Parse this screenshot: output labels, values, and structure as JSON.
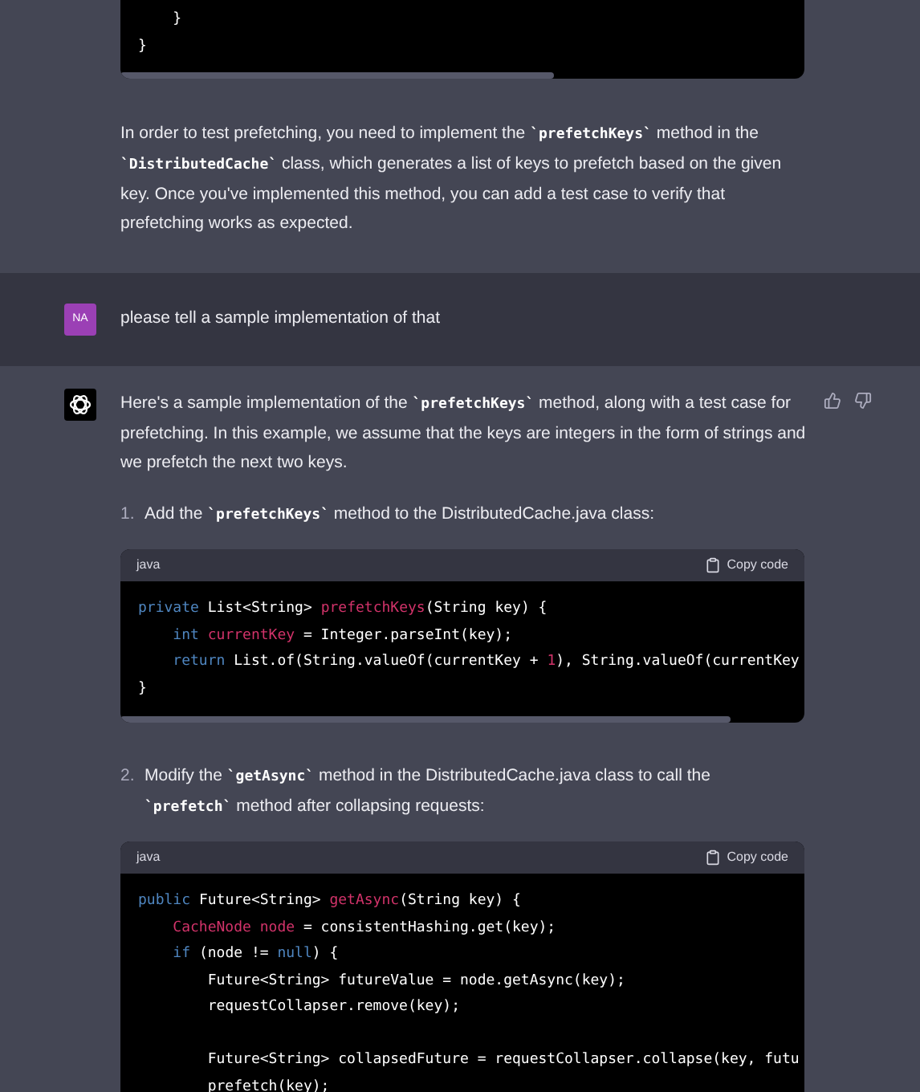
{
  "top_code_block": {
    "lines": [
      {
        "kind": "code",
        "tokens": [
          {
            "text": "    }",
            "kind": "plain"
          }
        ]
      },
      {
        "kind": "code",
        "tokens": [
          {
            "text": "}",
            "kind": "plain"
          }
        ]
      }
    ]
  },
  "assistant_message_1": {
    "paragraph": [
      {
        "text": "In order to test prefetching, you need to implement the ",
        "kind": "text"
      },
      {
        "text": "`prefetchKeys`",
        "kind": "code"
      },
      {
        "text": " method in the ",
        "kind": "text"
      },
      {
        "text": "`DistributedCache`",
        "kind": "code"
      },
      {
        "text": " class, which generates a list of keys to prefetch based on the given key. Once you've implemented this method, you can add a test case to verify that prefetching works as expected.",
        "kind": "text"
      }
    ]
  },
  "user_message": {
    "avatar": "NA",
    "text": "please tell a sample implementation of that"
  },
  "assistant_message_2": {
    "intro": [
      {
        "text": "Here's a sample implementation of the ",
        "kind": "text"
      },
      {
        "text": "`prefetchKeys`",
        "kind": "code"
      },
      {
        "text": " method, along with a test case for prefetching. In this example, we assume that the keys are integers in the form of strings and we prefetch the next two keys.",
        "kind": "text"
      }
    ],
    "steps": [
      {
        "number": "1.",
        "text": [
          {
            "text": "Add the ",
            "kind": "text"
          },
          {
            "text": "`prefetchKeys`",
            "kind": "code"
          },
          {
            "text": " method to the DistributedCache.java class:",
            "kind": "text"
          }
        ],
        "code_block": {
          "language": "java",
          "copy_label": "Copy code",
          "lines": [
            {
              "kind": "code",
              "tokens": [
                {
                  "text": "private ",
                  "kind": "keyword"
                },
                {
                  "text": "List<String> ",
                  "kind": "plain"
                },
                {
                  "text": "prefetchKeys",
                  "kind": "title"
                },
                {
                  "text": "(String key) {",
                  "kind": "plain"
                }
              ]
            },
            {
              "kind": "code",
              "tokens": [
                {
                  "text": "    int ",
                  "kind": "keyword"
                },
                {
                  "text": "currentKey",
                  "kind": "title"
                },
                {
                  "text": " = Integer.parseInt(key);",
                  "kind": "plain"
                }
              ]
            },
            {
              "kind": "code",
              "tokens": [
                {
                  "text": "    return ",
                  "kind": "keyword"
                },
                {
                  "text": "List.of(String.valueOf(currentKey + ",
                  "kind": "plain"
                },
                {
                  "text": "1",
                  "kind": "title"
                },
                {
                  "text": "), String.valueOf(currentKey",
                  "kind": "plain"
                }
              ]
            },
            {
              "kind": "code",
              "tokens": [
                {
                  "text": "}",
                  "kind": "plain"
                }
              ]
            }
          ]
        }
      },
      {
        "number": "2.",
        "text": [
          {
            "text": "Modify the ",
            "kind": "text"
          },
          {
            "text": "`getAsync`",
            "kind": "code"
          },
          {
            "text": " method in the DistributedCache.java class to call the ",
            "kind": "text"
          },
          {
            "text": "`prefetch`",
            "kind": "code"
          },
          {
            "text": " method after collapsing requests:",
            "kind": "text"
          }
        ],
        "code_block": {
          "language": "java",
          "copy_label": "Copy code",
          "lines": [
            {
              "kind": "code",
              "tokens": [
                {
                  "text": "public ",
                  "kind": "keyword"
                },
                {
                  "text": "Future<String> ",
                  "kind": "plain"
                },
                {
                  "text": "getAsync",
                  "kind": "title"
                },
                {
                  "text": "(String key) {",
                  "kind": "plain"
                }
              ]
            },
            {
              "kind": "code",
              "tokens": [
                {
                  "text": "    CacheNode node",
                  "kind": "title"
                },
                {
                  "text": " = consistentHashing.get(key);",
                  "kind": "plain"
                }
              ]
            },
            {
              "kind": "code",
              "tokens": [
                {
                  "text": "    if ",
                  "kind": "keyword"
                },
                {
                  "text": "(node != ",
                  "kind": "plain"
                },
                {
                  "text": "null",
                  "kind": "keyword"
                },
                {
                  "text": ") {",
                  "kind": "plain"
                }
              ]
            },
            {
              "kind": "code",
              "tokens": [
                {
                  "text": "        Future<String> futureValue = node.getAsync(key);",
                  "kind": "plain"
                }
              ]
            },
            {
              "kind": "code",
              "tokens": [
                {
                  "text": "        requestCollapser.remove(key);",
                  "kind": "plain"
                }
              ]
            },
            {
              "kind": "blank"
            },
            {
              "kind": "code",
              "tokens": [
                {
                  "text": "        Future<String> collapsedFuture = requestCollapser.collapse(key, futu",
                  "kind": "plain"
                }
              ]
            },
            {
              "kind": "code",
              "tokens": [
                {
                  "text": "        prefetch(key);",
                  "kind": "plain"
                }
              ]
            }
          ]
        }
      }
    ]
  }
}
